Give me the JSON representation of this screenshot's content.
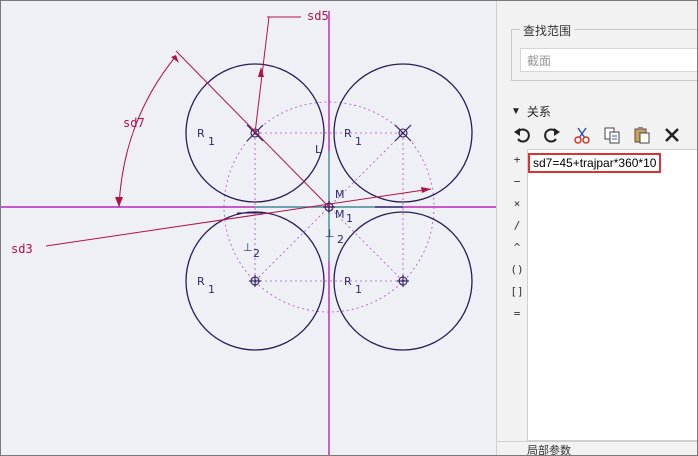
{
  "canvas": {
    "dimensions": {
      "sd5": "sd5",
      "sd7": "sd7",
      "sd3": "sd3"
    },
    "labels": {
      "r": "R",
      "sub1": "1",
      "m": "M",
      "m1": "M",
      "one": "1",
      "two": "2",
      "l": "L"
    },
    "colors": {
      "circle": "#2b1a5a",
      "dim": "#b0124a",
      "axis": "#b000b0",
      "center": "#2a9a8a"
    }
  },
  "panel": {
    "range_title": "查找范围",
    "range_value": "截面",
    "relations_header": "关系",
    "toolbar": [
      "undo-icon",
      "redo-icon",
      "cut-icon",
      "copy-icon",
      "paste-icon",
      "delete-icon"
    ],
    "operators": [
      "+",
      "−",
      "×",
      "/",
      "^",
      "()",
      "[]",
      "="
    ],
    "relation_text": "sd7=45+trajpar*360*10",
    "bottom_label": "局部参数"
  }
}
